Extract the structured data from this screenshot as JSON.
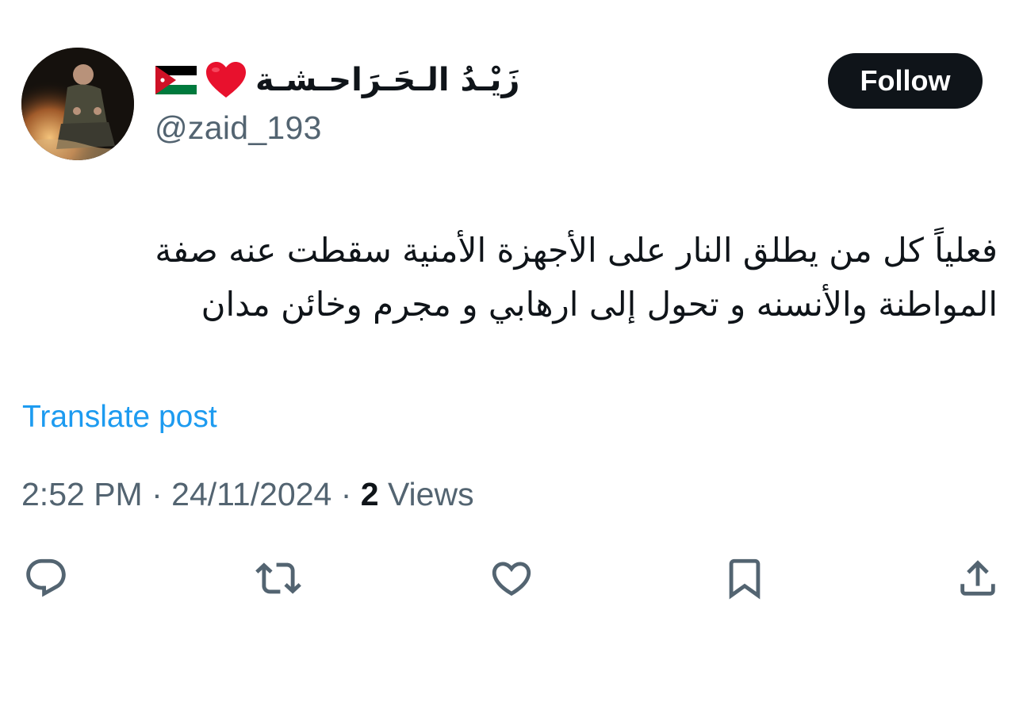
{
  "author": {
    "display_name": "زَيْـدُ الـحَـرَاحـشـة",
    "handle": "@zaid_193",
    "avatar_icon": "avatar-photo",
    "flag_icon": "jordan-flag",
    "emoji_icon": "red-heart"
  },
  "follow": {
    "label": "Follow"
  },
  "post": {
    "text_line_1": "فعلياً كل من يطلق النار على الأجهزة الأمنية سقطت عنه صفة",
    "text_line_2": "المواطنة والأنسنه و تحول إلى ارهابي و مجرم وخائن مدان",
    "translate_label": "Translate post"
  },
  "meta": {
    "time": "2:52 PM",
    "separator": " · ",
    "date": "24/11/2024",
    "views_count": "2",
    "views_label": " Views"
  },
  "actions": [
    {
      "icon": "reply-icon"
    },
    {
      "icon": "repost-icon"
    },
    {
      "icon": "like-icon"
    },
    {
      "icon": "bookmark-icon"
    },
    {
      "icon": "share-icon"
    }
  ],
  "colors": {
    "text": "#0f1419",
    "secondary": "#536471",
    "link": "#1d9bf0",
    "follow_bg": "#0f1419",
    "follow_text": "#ffffff"
  }
}
